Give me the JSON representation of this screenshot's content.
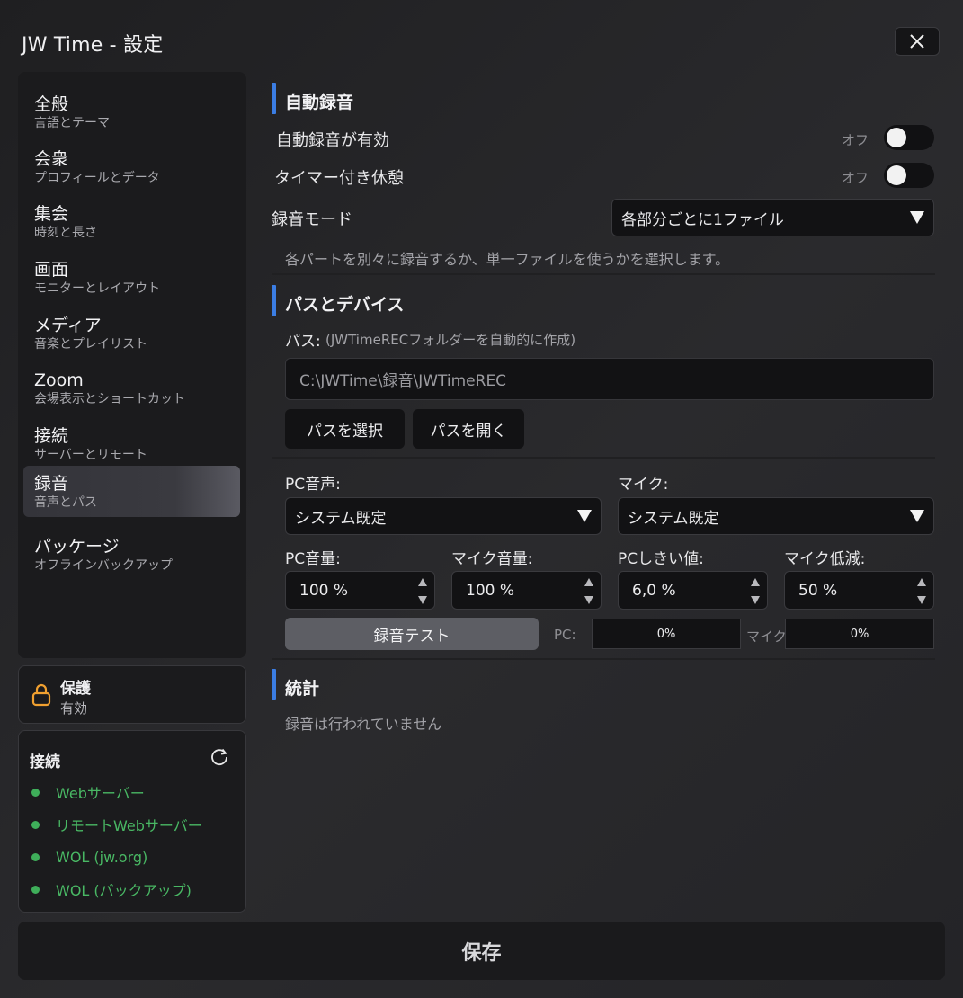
{
  "window": {
    "title": "JW Time - 設定"
  },
  "sidebar": {
    "items": [
      {
        "label": "全般",
        "sub": "言語とテーマ"
      },
      {
        "label": "会衆",
        "sub": "プロフィールとデータ"
      },
      {
        "label": "集会",
        "sub": "時刻と長さ"
      },
      {
        "label": "画面",
        "sub": "モニターとレイアウト"
      },
      {
        "label": "メディア",
        "sub": "音楽とプレイリスト"
      },
      {
        "label": "Zoom",
        "sub": "会場表示とショートカット"
      },
      {
        "label": "接続",
        "sub": "サーバーとリモート"
      },
      {
        "label": "録音",
        "sub": "音声とパス"
      },
      {
        "label": "パッケージ",
        "sub": "オフラインバックアップ"
      }
    ],
    "active_index": 7
  },
  "protection": {
    "title": "保護",
    "status": "有効"
  },
  "connections": {
    "title": "接続",
    "items": [
      "Webサーバー",
      "リモートWebサーバー",
      "WOL (jw.org)",
      "WOL (バックアップ)"
    ],
    "status_color": "#3fae5a"
  },
  "auto_record": {
    "title": "自動録音",
    "enabled_label": "自動録音が有効",
    "enabled_state": "オフ",
    "break_label": "タイマー付き休憩",
    "break_state": "オフ",
    "mode_label": "録音モード",
    "mode_value": "各部分ごとに1ファイル",
    "mode_hint": "各パートを別々に録音するか、単一ファイルを使うかを選択します。"
  },
  "paths": {
    "title": "パスとデバイス",
    "path_label": "パス:",
    "path_hint": "(JWTimeRECフォルダーを自動的に作成)",
    "path_value": "C:\\JWTime\\録音\\JWTimeREC",
    "choose_button": "パスを選択",
    "open_button": "パスを開く",
    "pc_audio_label": "PC音声:",
    "pc_audio_value": "システム既定",
    "mic_label": "マイク:",
    "mic_value": "システム既定",
    "pc_volume_label": "PC音量:",
    "pc_volume_value": "100 %",
    "mic_volume_label": "マイク音量:",
    "mic_volume_value": "100 %",
    "pc_threshold_label": "PCしきい値:",
    "pc_threshold_value": "6,0 %",
    "mic_reduce_label": "マイク低減:",
    "mic_reduce_value": "50 %",
    "test_button": "録音テスト",
    "pc_meter_label": "PC:",
    "pc_meter_value": "0%",
    "mic_meter_label": "マイク",
    "mic_meter_value": "0%"
  },
  "stats": {
    "title": "統計",
    "empty": "録音は行われていません"
  },
  "footer": {
    "save_label": "保存"
  },
  "colors": {
    "accent": "#3b7de3",
    "status_green": "#3fae5a"
  }
}
